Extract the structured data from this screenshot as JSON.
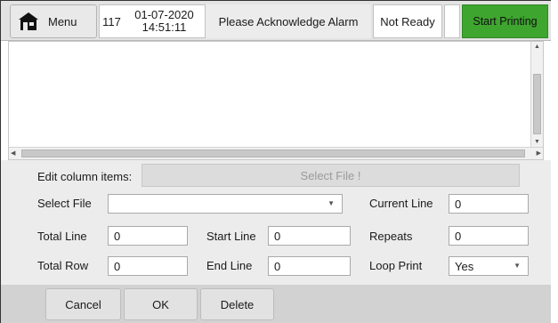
{
  "header": {
    "menu_label": "Menu",
    "menu_icon": "home-icon",
    "counter": "117",
    "date": "01-07-2020",
    "time": "14:51:11",
    "message": "Please Acknowledge Alarm",
    "status": "Not Ready",
    "start_label": "Start Printing",
    "start_color": "#3ea52f"
  },
  "form": {
    "edit_column_label": "Edit column items:",
    "edit_column_placeholder": "Select File !",
    "select_file_label": "Select File",
    "select_file_value": "",
    "current_line_label": "Current Line",
    "current_line_value": "0",
    "total_line_label": "Total Line",
    "total_line_value": "0",
    "start_line_label": "Start Line",
    "start_line_value": "0",
    "repeats_label": "Repeats",
    "repeats_value": "0",
    "total_row_label": "Total Row",
    "total_row_value": "0",
    "end_line_label": "End Line",
    "end_line_value": "0",
    "loop_print_label": "Loop Print",
    "loop_print_value": "Yes"
  },
  "buttons": {
    "cancel": "Cancel",
    "ok": "OK",
    "delete": "Delete"
  }
}
